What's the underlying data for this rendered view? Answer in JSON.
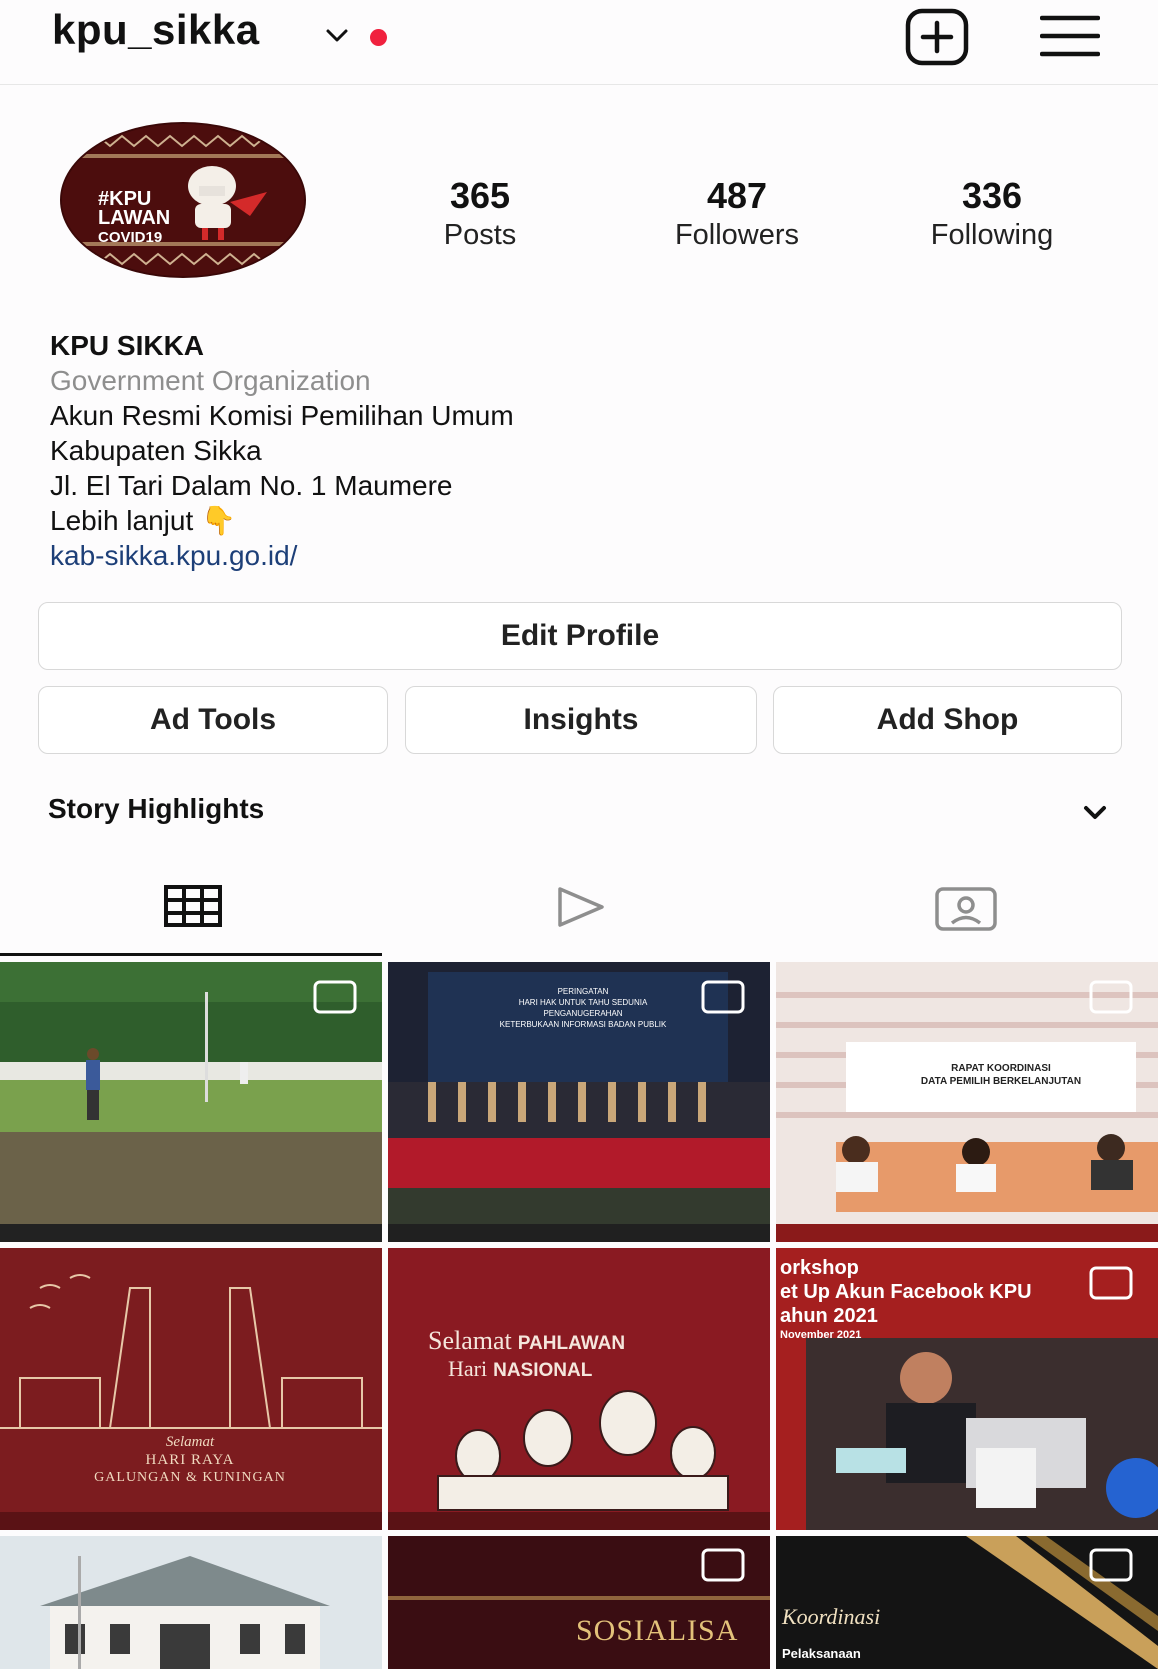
{
  "header": {
    "username": "kpu_sikka",
    "icons": [
      "chevron-down-icon",
      "notification-dot",
      "new-post-icon",
      "menu-icon"
    ],
    "accent_red": "#f0213e"
  },
  "avatar": {
    "lines": [
      "#KPU",
      "LAWAN",
      "COVID19"
    ]
  },
  "stats": [
    {
      "value": "365",
      "label": "Posts"
    },
    {
      "value": "487",
      "label": "Followers"
    },
    {
      "value": "336",
      "label": "Following"
    }
  ],
  "bio": {
    "name": "KPU SIKKA",
    "category": "Government Organization",
    "line1": "Akun Resmi Komisi Pemilihan Umum",
    "line2": "Kabupaten Sikka",
    "line3": "Jl. El Tari Dalam No. 1 Maumere",
    "line4": "Lebih lanjut",
    "line4_emoji": "👇",
    "link": "kab-sikka.kpu.go.id/",
    "link_color": "#1d3f78"
  },
  "buttons": {
    "edit_profile": "Edit Profile",
    "ad_tools": "Ad Tools",
    "insights": "Insights",
    "add_shop": "Add Shop"
  },
  "highlights": {
    "label": "Story Highlights"
  },
  "tabs": [
    "grid-icon",
    "reels-icon",
    "tagged-icon"
  ],
  "posts": [
    {
      "id": "field",
      "lines": []
    },
    {
      "id": "ceremony",
      "lines": [
        "PERINGATAN",
        "HARI HAK UNTUK TAHU SEDUNIA",
        "PENGANUGERAHAN",
        "KETERBUKAAN INFORMASI BADAN PUBLIK"
      ]
    },
    {
      "id": "meeting",
      "lines": [
        "RAPAT KOORDINASI",
        "DATA PEMILIH BERKELANJUTAN"
      ]
    },
    {
      "id": "galungan",
      "lines": [
        "Selamat",
        "HARI RAYA",
        "GALUNGAN & KUNINGAN"
      ]
    },
    {
      "id": "pahlawan",
      "lines": [
        "Selamat",
        "Hari",
        "PAHLAWAN",
        "NASIONAL"
      ]
    },
    {
      "id": "workshop",
      "lines": [
        "orkshop",
        "et Up Akun Facebook KPU",
        "ahun 2021",
        "November 2021"
      ]
    },
    {
      "id": "building",
      "lines": []
    },
    {
      "id": "sosialisasi",
      "lines": [
        "SOSIALISA"
      ]
    },
    {
      "id": "koordinasi",
      "lines": [
        "Koordinasi",
        "Pelaksanaan"
      ]
    }
  ]
}
